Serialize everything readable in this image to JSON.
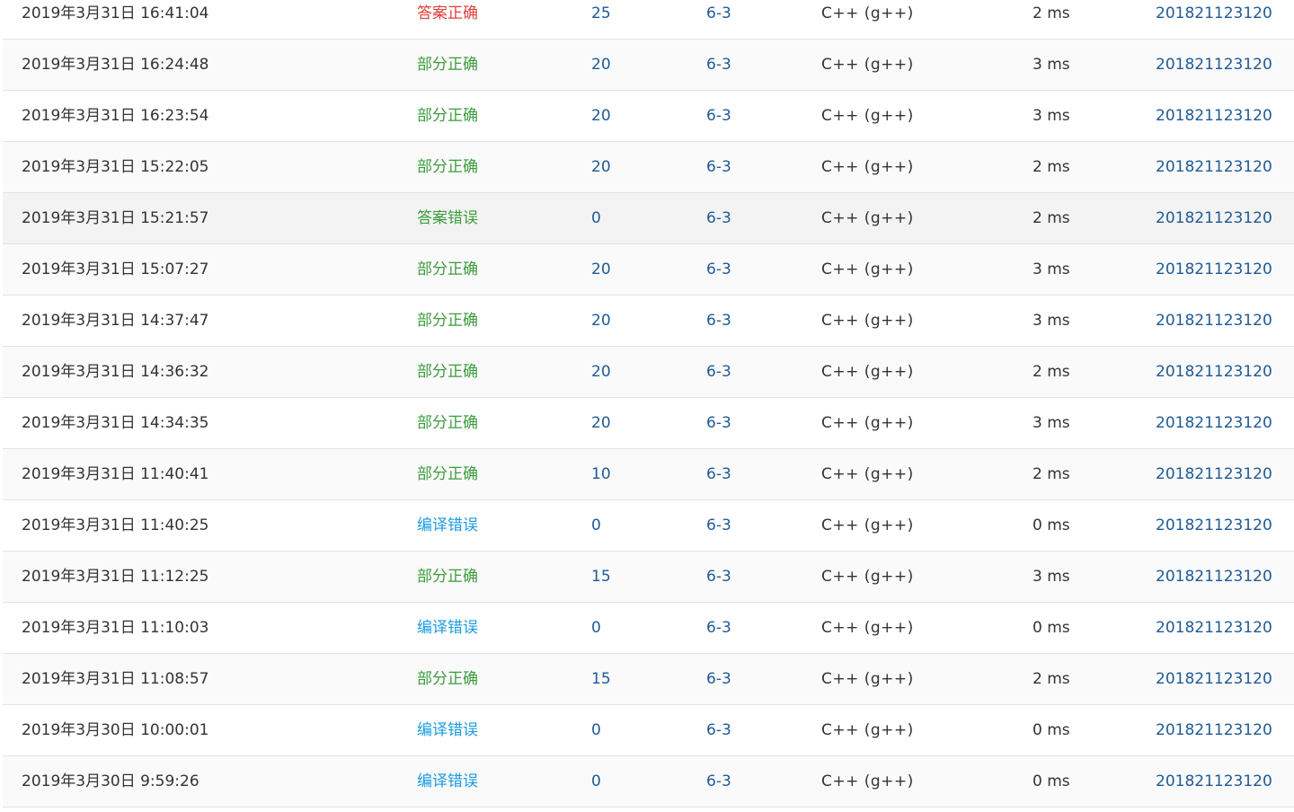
{
  "colors": {
    "accepted": "#e0403a",
    "partial": "#3d9c3d",
    "wrong_answer": "#3d9c3d",
    "compile_error": "#1a9be0",
    "link": "#1f5a96"
  },
  "submissions": [
    {
      "time": "2019年3月31日 16:41:04",
      "status": "答案正确",
      "status_type": "accepted",
      "score": "25",
      "problem": "6-3",
      "compiler": "C++ (g++)",
      "time_used": "2 ms",
      "user": "201821123120"
    },
    {
      "time": "2019年3月31日 16:24:48",
      "status": "部分正确",
      "status_type": "partial",
      "score": "20",
      "problem": "6-3",
      "compiler": "C++ (g++)",
      "time_used": "3 ms",
      "user": "201821123120"
    },
    {
      "time": "2019年3月31日 16:23:54",
      "status": "部分正确",
      "status_type": "partial",
      "score": "20",
      "problem": "6-3",
      "compiler": "C++ (g++)",
      "time_used": "3 ms",
      "user": "201821123120"
    },
    {
      "time": "2019年3月31日 15:22:05",
      "status": "部分正确",
      "status_type": "partial",
      "score": "20",
      "problem": "6-3",
      "compiler": "C++ (g++)",
      "time_used": "2 ms",
      "user": "201821123120"
    },
    {
      "time": "2019年3月31日 15:21:57",
      "status": "答案错误",
      "status_type": "wrong_answer",
      "score": "0",
      "problem": "6-3",
      "compiler": "C++ (g++)",
      "time_used": "2 ms",
      "user": "201821123120"
    },
    {
      "time": "2019年3月31日 15:07:27",
      "status": "部分正确",
      "status_type": "partial",
      "score": "20",
      "problem": "6-3",
      "compiler": "C++ (g++)",
      "time_used": "3 ms",
      "user": "201821123120"
    },
    {
      "time": "2019年3月31日 14:37:47",
      "status": "部分正确",
      "status_type": "partial",
      "score": "20",
      "problem": "6-3",
      "compiler": "C++ (g++)",
      "time_used": "3 ms",
      "user": "201821123120"
    },
    {
      "time": "2019年3月31日 14:36:32",
      "status": "部分正确",
      "status_type": "partial",
      "score": "20",
      "problem": "6-3",
      "compiler": "C++ (g++)",
      "time_used": "2 ms",
      "user": "201821123120"
    },
    {
      "time": "2019年3月31日 14:34:35",
      "status": "部分正确",
      "status_type": "partial",
      "score": "20",
      "problem": "6-3",
      "compiler": "C++ (g++)",
      "time_used": "3 ms",
      "user": "201821123120"
    },
    {
      "time": "2019年3月31日 11:40:41",
      "status": "部分正确",
      "status_type": "partial",
      "score": "10",
      "problem": "6-3",
      "compiler": "C++ (g++)",
      "time_used": "2 ms",
      "user": "201821123120"
    },
    {
      "time": "2019年3月31日 11:40:25",
      "status": "编译错误",
      "status_type": "compile_error",
      "score": "0",
      "problem": "6-3",
      "compiler": "C++ (g++)",
      "time_used": "0 ms",
      "user": "201821123120"
    },
    {
      "time": "2019年3月31日 11:12:25",
      "status": "部分正确",
      "status_type": "partial",
      "score": "15",
      "problem": "6-3",
      "compiler": "C++ (g++)",
      "time_used": "3 ms",
      "user": "201821123120"
    },
    {
      "time": "2019年3月31日 11:10:03",
      "status": "编译错误",
      "status_type": "compile_error",
      "score": "0",
      "problem": "6-3",
      "compiler": "C++ (g++)",
      "time_used": "0 ms",
      "user": "201821123120"
    },
    {
      "time": "2019年3月31日 11:08:57",
      "status": "部分正确",
      "status_type": "partial",
      "score": "15",
      "problem": "6-3",
      "compiler": "C++ (g++)",
      "time_used": "2 ms",
      "user": "201821123120"
    },
    {
      "time": "2019年3月30日 10:00:01",
      "status": "编译错误",
      "status_type": "compile_error",
      "score": "0",
      "problem": "6-3",
      "compiler": "C++ (g++)",
      "time_used": "0 ms",
      "user": "201821123120"
    },
    {
      "time": "2019年3月30日 9:59:26",
      "status": "编译错误",
      "status_type": "compile_error",
      "score": "0",
      "problem": "6-3",
      "compiler": "C++ (g++)",
      "time_used": "0 ms",
      "user": "201821123120"
    }
  ]
}
